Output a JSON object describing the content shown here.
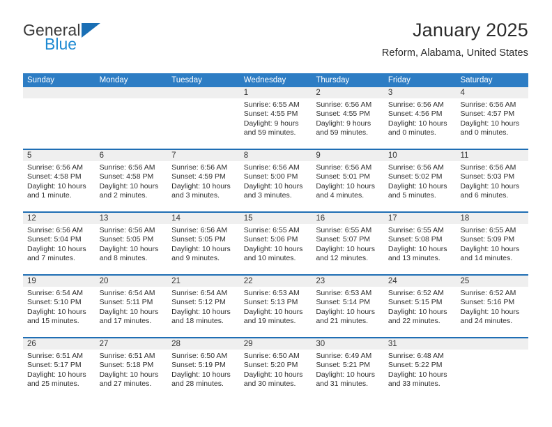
{
  "brand": {
    "word1": "General",
    "word2": "Blue",
    "triangle_color": "#1a6fb5",
    "blue_text_color": "#1f8ad2"
  },
  "header": {
    "title": "January 2025",
    "subtitle": "Reform, Alabama, United States"
  },
  "theme": {
    "header_blue": "#2d7dc4",
    "row_divider_blue": "#1f6eb4",
    "daynum_band": "#efefef"
  },
  "weekdays": [
    "Sunday",
    "Monday",
    "Tuesday",
    "Wednesday",
    "Thursday",
    "Friday",
    "Saturday"
  ],
  "weeks": [
    [
      {
        "day": "",
        "empty": true
      },
      {
        "day": "",
        "empty": true
      },
      {
        "day": "",
        "empty": true
      },
      {
        "day": "1",
        "sunrise": "Sunrise: 6:55 AM",
        "sunset": "Sunset: 4:55 PM",
        "daylight1": "Daylight: 9 hours",
        "daylight2": "and 59 minutes."
      },
      {
        "day": "2",
        "sunrise": "Sunrise: 6:56 AM",
        "sunset": "Sunset: 4:55 PM",
        "daylight1": "Daylight: 9 hours",
        "daylight2": "and 59 minutes."
      },
      {
        "day": "3",
        "sunrise": "Sunrise: 6:56 AM",
        "sunset": "Sunset: 4:56 PM",
        "daylight1": "Daylight: 10 hours",
        "daylight2": "and 0 minutes."
      },
      {
        "day": "4",
        "sunrise": "Sunrise: 6:56 AM",
        "sunset": "Sunset: 4:57 PM",
        "daylight1": "Daylight: 10 hours",
        "daylight2": "and 0 minutes."
      }
    ],
    [
      {
        "day": "5",
        "sunrise": "Sunrise: 6:56 AM",
        "sunset": "Sunset: 4:58 PM",
        "daylight1": "Daylight: 10 hours",
        "daylight2": "and 1 minute."
      },
      {
        "day": "6",
        "sunrise": "Sunrise: 6:56 AM",
        "sunset": "Sunset: 4:58 PM",
        "daylight1": "Daylight: 10 hours",
        "daylight2": "and 2 minutes."
      },
      {
        "day": "7",
        "sunrise": "Sunrise: 6:56 AM",
        "sunset": "Sunset: 4:59 PM",
        "daylight1": "Daylight: 10 hours",
        "daylight2": "and 3 minutes."
      },
      {
        "day": "8",
        "sunrise": "Sunrise: 6:56 AM",
        "sunset": "Sunset: 5:00 PM",
        "daylight1": "Daylight: 10 hours",
        "daylight2": "and 3 minutes."
      },
      {
        "day": "9",
        "sunrise": "Sunrise: 6:56 AM",
        "sunset": "Sunset: 5:01 PM",
        "daylight1": "Daylight: 10 hours",
        "daylight2": "and 4 minutes."
      },
      {
        "day": "10",
        "sunrise": "Sunrise: 6:56 AM",
        "sunset": "Sunset: 5:02 PM",
        "daylight1": "Daylight: 10 hours",
        "daylight2": "and 5 minutes."
      },
      {
        "day": "11",
        "sunrise": "Sunrise: 6:56 AM",
        "sunset": "Sunset: 5:03 PM",
        "daylight1": "Daylight: 10 hours",
        "daylight2": "and 6 minutes."
      }
    ],
    [
      {
        "day": "12",
        "sunrise": "Sunrise: 6:56 AM",
        "sunset": "Sunset: 5:04 PM",
        "daylight1": "Daylight: 10 hours",
        "daylight2": "and 7 minutes."
      },
      {
        "day": "13",
        "sunrise": "Sunrise: 6:56 AM",
        "sunset": "Sunset: 5:05 PM",
        "daylight1": "Daylight: 10 hours",
        "daylight2": "and 8 minutes."
      },
      {
        "day": "14",
        "sunrise": "Sunrise: 6:56 AM",
        "sunset": "Sunset: 5:05 PM",
        "daylight1": "Daylight: 10 hours",
        "daylight2": "and 9 minutes."
      },
      {
        "day": "15",
        "sunrise": "Sunrise: 6:55 AM",
        "sunset": "Sunset: 5:06 PM",
        "daylight1": "Daylight: 10 hours",
        "daylight2": "and 10 minutes."
      },
      {
        "day": "16",
        "sunrise": "Sunrise: 6:55 AM",
        "sunset": "Sunset: 5:07 PM",
        "daylight1": "Daylight: 10 hours",
        "daylight2": "and 12 minutes."
      },
      {
        "day": "17",
        "sunrise": "Sunrise: 6:55 AM",
        "sunset": "Sunset: 5:08 PM",
        "daylight1": "Daylight: 10 hours",
        "daylight2": "and 13 minutes."
      },
      {
        "day": "18",
        "sunrise": "Sunrise: 6:55 AM",
        "sunset": "Sunset: 5:09 PM",
        "daylight1": "Daylight: 10 hours",
        "daylight2": "and 14 minutes."
      }
    ],
    [
      {
        "day": "19",
        "sunrise": "Sunrise: 6:54 AM",
        "sunset": "Sunset: 5:10 PM",
        "daylight1": "Daylight: 10 hours",
        "daylight2": "and 15 minutes."
      },
      {
        "day": "20",
        "sunrise": "Sunrise: 6:54 AM",
        "sunset": "Sunset: 5:11 PM",
        "daylight1": "Daylight: 10 hours",
        "daylight2": "and 17 minutes."
      },
      {
        "day": "21",
        "sunrise": "Sunrise: 6:54 AM",
        "sunset": "Sunset: 5:12 PM",
        "daylight1": "Daylight: 10 hours",
        "daylight2": "and 18 minutes."
      },
      {
        "day": "22",
        "sunrise": "Sunrise: 6:53 AM",
        "sunset": "Sunset: 5:13 PM",
        "daylight1": "Daylight: 10 hours",
        "daylight2": "and 19 minutes."
      },
      {
        "day": "23",
        "sunrise": "Sunrise: 6:53 AM",
        "sunset": "Sunset: 5:14 PM",
        "daylight1": "Daylight: 10 hours",
        "daylight2": "and 21 minutes."
      },
      {
        "day": "24",
        "sunrise": "Sunrise: 6:52 AM",
        "sunset": "Sunset: 5:15 PM",
        "daylight1": "Daylight: 10 hours",
        "daylight2": "and 22 minutes."
      },
      {
        "day": "25",
        "sunrise": "Sunrise: 6:52 AM",
        "sunset": "Sunset: 5:16 PM",
        "daylight1": "Daylight: 10 hours",
        "daylight2": "and 24 minutes."
      }
    ],
    [
      {
        "day": "26",
        "sunrise": "Sunrise: 6:51 AM",
        "sunset": "Sunset: 5:17 PM",
        "daylight1": "Daylight: 10 hours",
        "daylight2": "and 25 minutes."
      },
      {
        "day": "27",
        "sunrise": "Sunrise: 6:51 AM",
        "sunset": "Sunset: 5:18 PM",
        "daylight1": "Daylight: 10 hours",
        "daylight2": "and 27 minutes."
      },
      {
        "day": "28",
        "sunrise": "Sunrise: 6:50 AM",
        "sunset": "Sunset: 5:19 PM",
        "daylight1": "Daylight: 10 hours",
        "daylight2": "and 28 minutes."
      },
      {
        "day": "29",
        "sunrise": "Sunrise: 6:50 AM",
        "sunset": "Sunset: 5:20 PM",
        "daylight1": "Daylight: 10 hours",
        "daylight2": "and 30 minutes."
      },
      {
        "day": "30",
        "sunrise": "Sunrise: 6:49 AM",
        "sunset": "Sunset: 5:21 PM",
        "daylight1": "Daylight: 10 hours",
        "daylight2": "and 31 minutes."
      },
      {
        "day": "31",
        "sunrise": "Sunrise: 6:48 AM",
        "sunset": "Sunset: 5:22 PM",
        "daylight1": "Daylight: 10 hours",
        "daylight2": "and 33 minutes."
      },
      {
        "day": "",
        "empty": true
      }
    ]
  ]
}
